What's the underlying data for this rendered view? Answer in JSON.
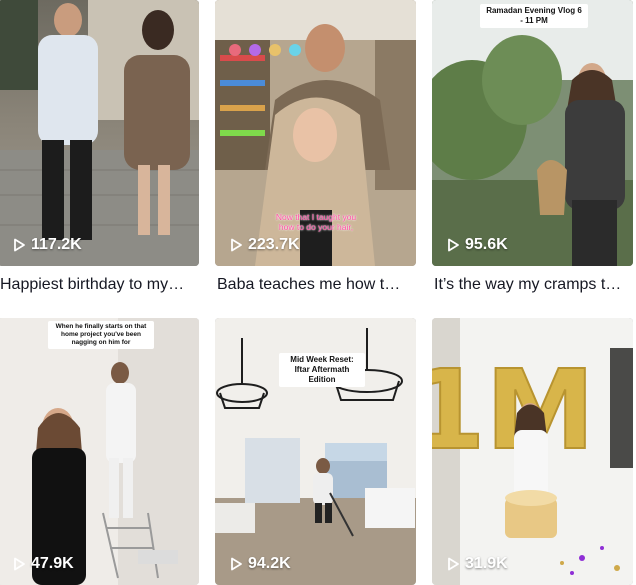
{
  "videos": [
    {
      "views": "117.2K",
      "caption": "Happiest birthday to my…",
      "overlay": ""
    },
    {
      "views": "223.7K",
      "caption": "Baba teaches me how t…",
      "overlay": "Now that I taught you how to do your hair,"
    },
    {
      "views": "95.6K",
      "caption": "It’s the way my cramps t…",
      "overlay": "Ramadan Evening Vlog 6 - 11 PM"
    },
    {
      "views": "47.9K",
      "caption": "",
      "overlay": "When he finally starts on that home project you've been nagging on him for"
    },
    {
      "views": "94.2K",
      "caption": "",
      "overlay": "Mid Week Reset: Iftar Aftermath Edition"
    },
    {
      "views": "31.9K",
      "caption": "",
      "overlay": "1M"
    }
  ],
  "icons": {
    "play": "play-icon"
  }
}
